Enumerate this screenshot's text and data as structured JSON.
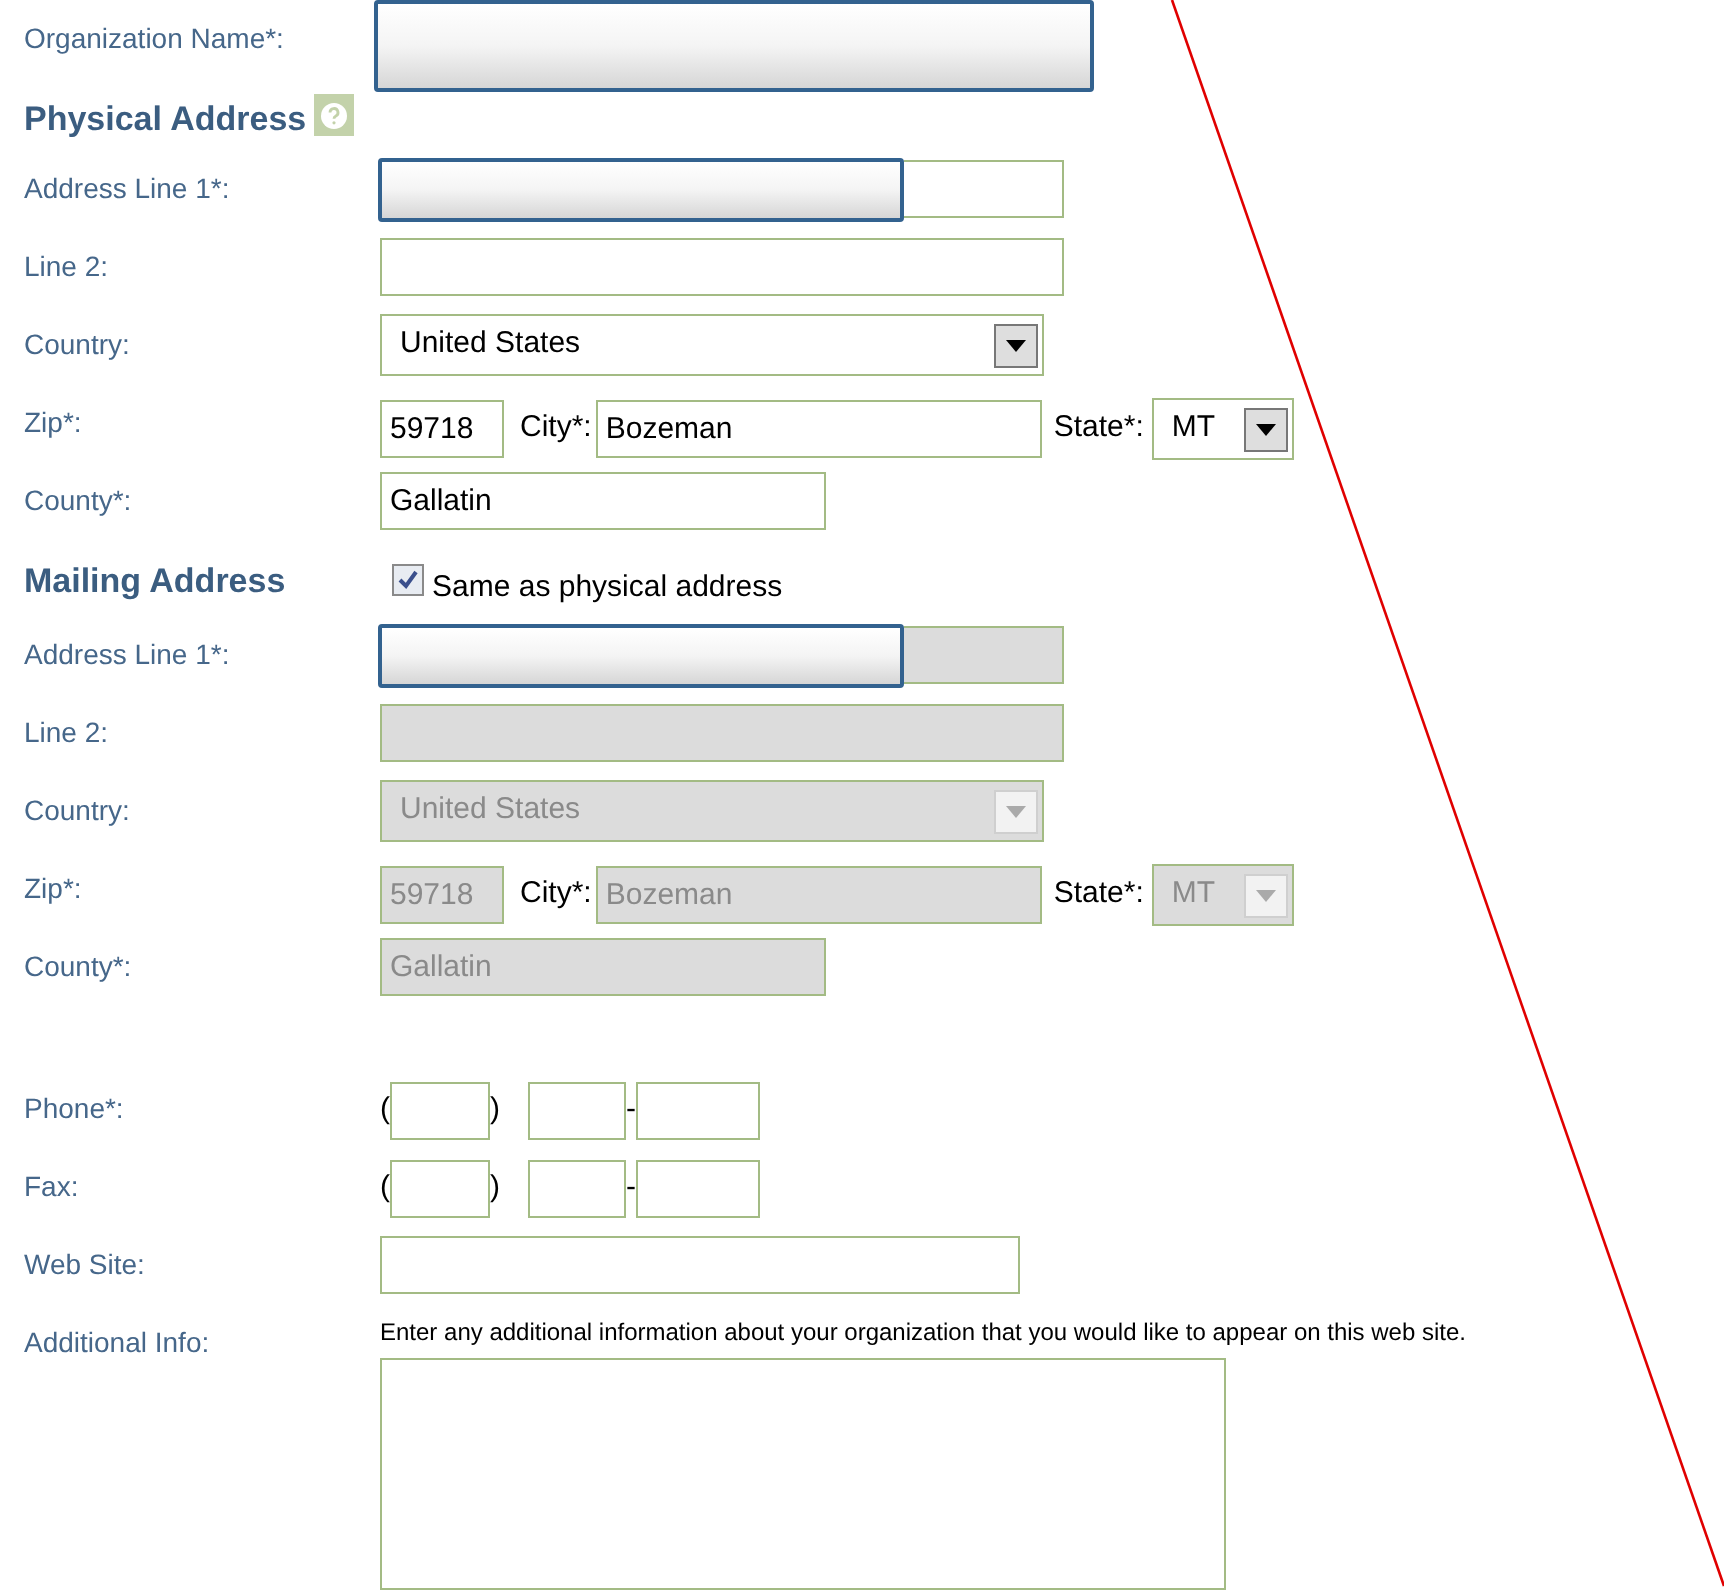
{
  "form": [
    {
      "kind": "tall_text",
      "label": "Organization Name*:",
      "redacted": true
    },
    {
      "kind": "heading",
      "text": "Physical Address",
      "help": true
    },
    {
      "kind": "text",
      "label": "Address Line 1*:",
      "redacted": true,
      "disabled": false
    },
    {
      "kind": "text",
      "label": "Line 2:",
      "redacted": false,
      "disabled": false
    },
    {
      "kind": "select",
      "label": "Country:",
      "value": "United States",
      "disabled": false
    },
    {
      "kind": "zip",
      "label": "Zip*:",
      "zip": "59718",
      "city_label": "City*:",
      "city": "Bozeman",
      "state_label": "State*:",
      "state": "MT",
      "disabled": false
    },
    {
      "kind": "short_text",
      "label": "County*:",
      "value": "Gallatin",
      "disabled": false
    },
    {
      "kind": "heading",
      "text": "Mailing Address",
      "checkbox": {
        "label": "Same as physical address",
        "checked": true
      }
    },
    {
      "kind": "text",
      "label": "Address Line 1*:",
      "redacted": true,
      "disabled": true
    },
    {
      "kind": "text",
      "label": "Line 2:",
      "redacted": false,
      "disabled": true
    },
    {
      "kind": "select",
      "label": "Country:",
      "value": "United States",
      "disabled": true
    },
    {
      "kind": "zip",
      "label": "Zip*:",
      "zip": "59718",
      "city_label": "City*:",
      "city": "Bozeman",
      "state_label": "State*:",
      "state": "MT",
      "disabled": true
    },
    {
      "kind": "short_text",
      "label": "County*:",
      "value": "Gallatin",
      "disabled": true
    },
    {
      "kind": "phone",
      "label": "Phone*:",
      "open": "(",
      "close": ")",
      "dash": "-"
    },
    {
      "kind": "phone",
      "label": "Fax:",
      "open": "(",
      "close": ")",
      "dash": "-"
    },
    {
      "kind": "medium_text",
      "label": "Web Site:",
      "redacted": false,
      "disabled": false
    },
    {
      "kind": "textarea",
      "label": "Additional Info:",
      "hint": "Enter any additional information about your organization that you would like to appear on this web site."
    }
  ]
}
